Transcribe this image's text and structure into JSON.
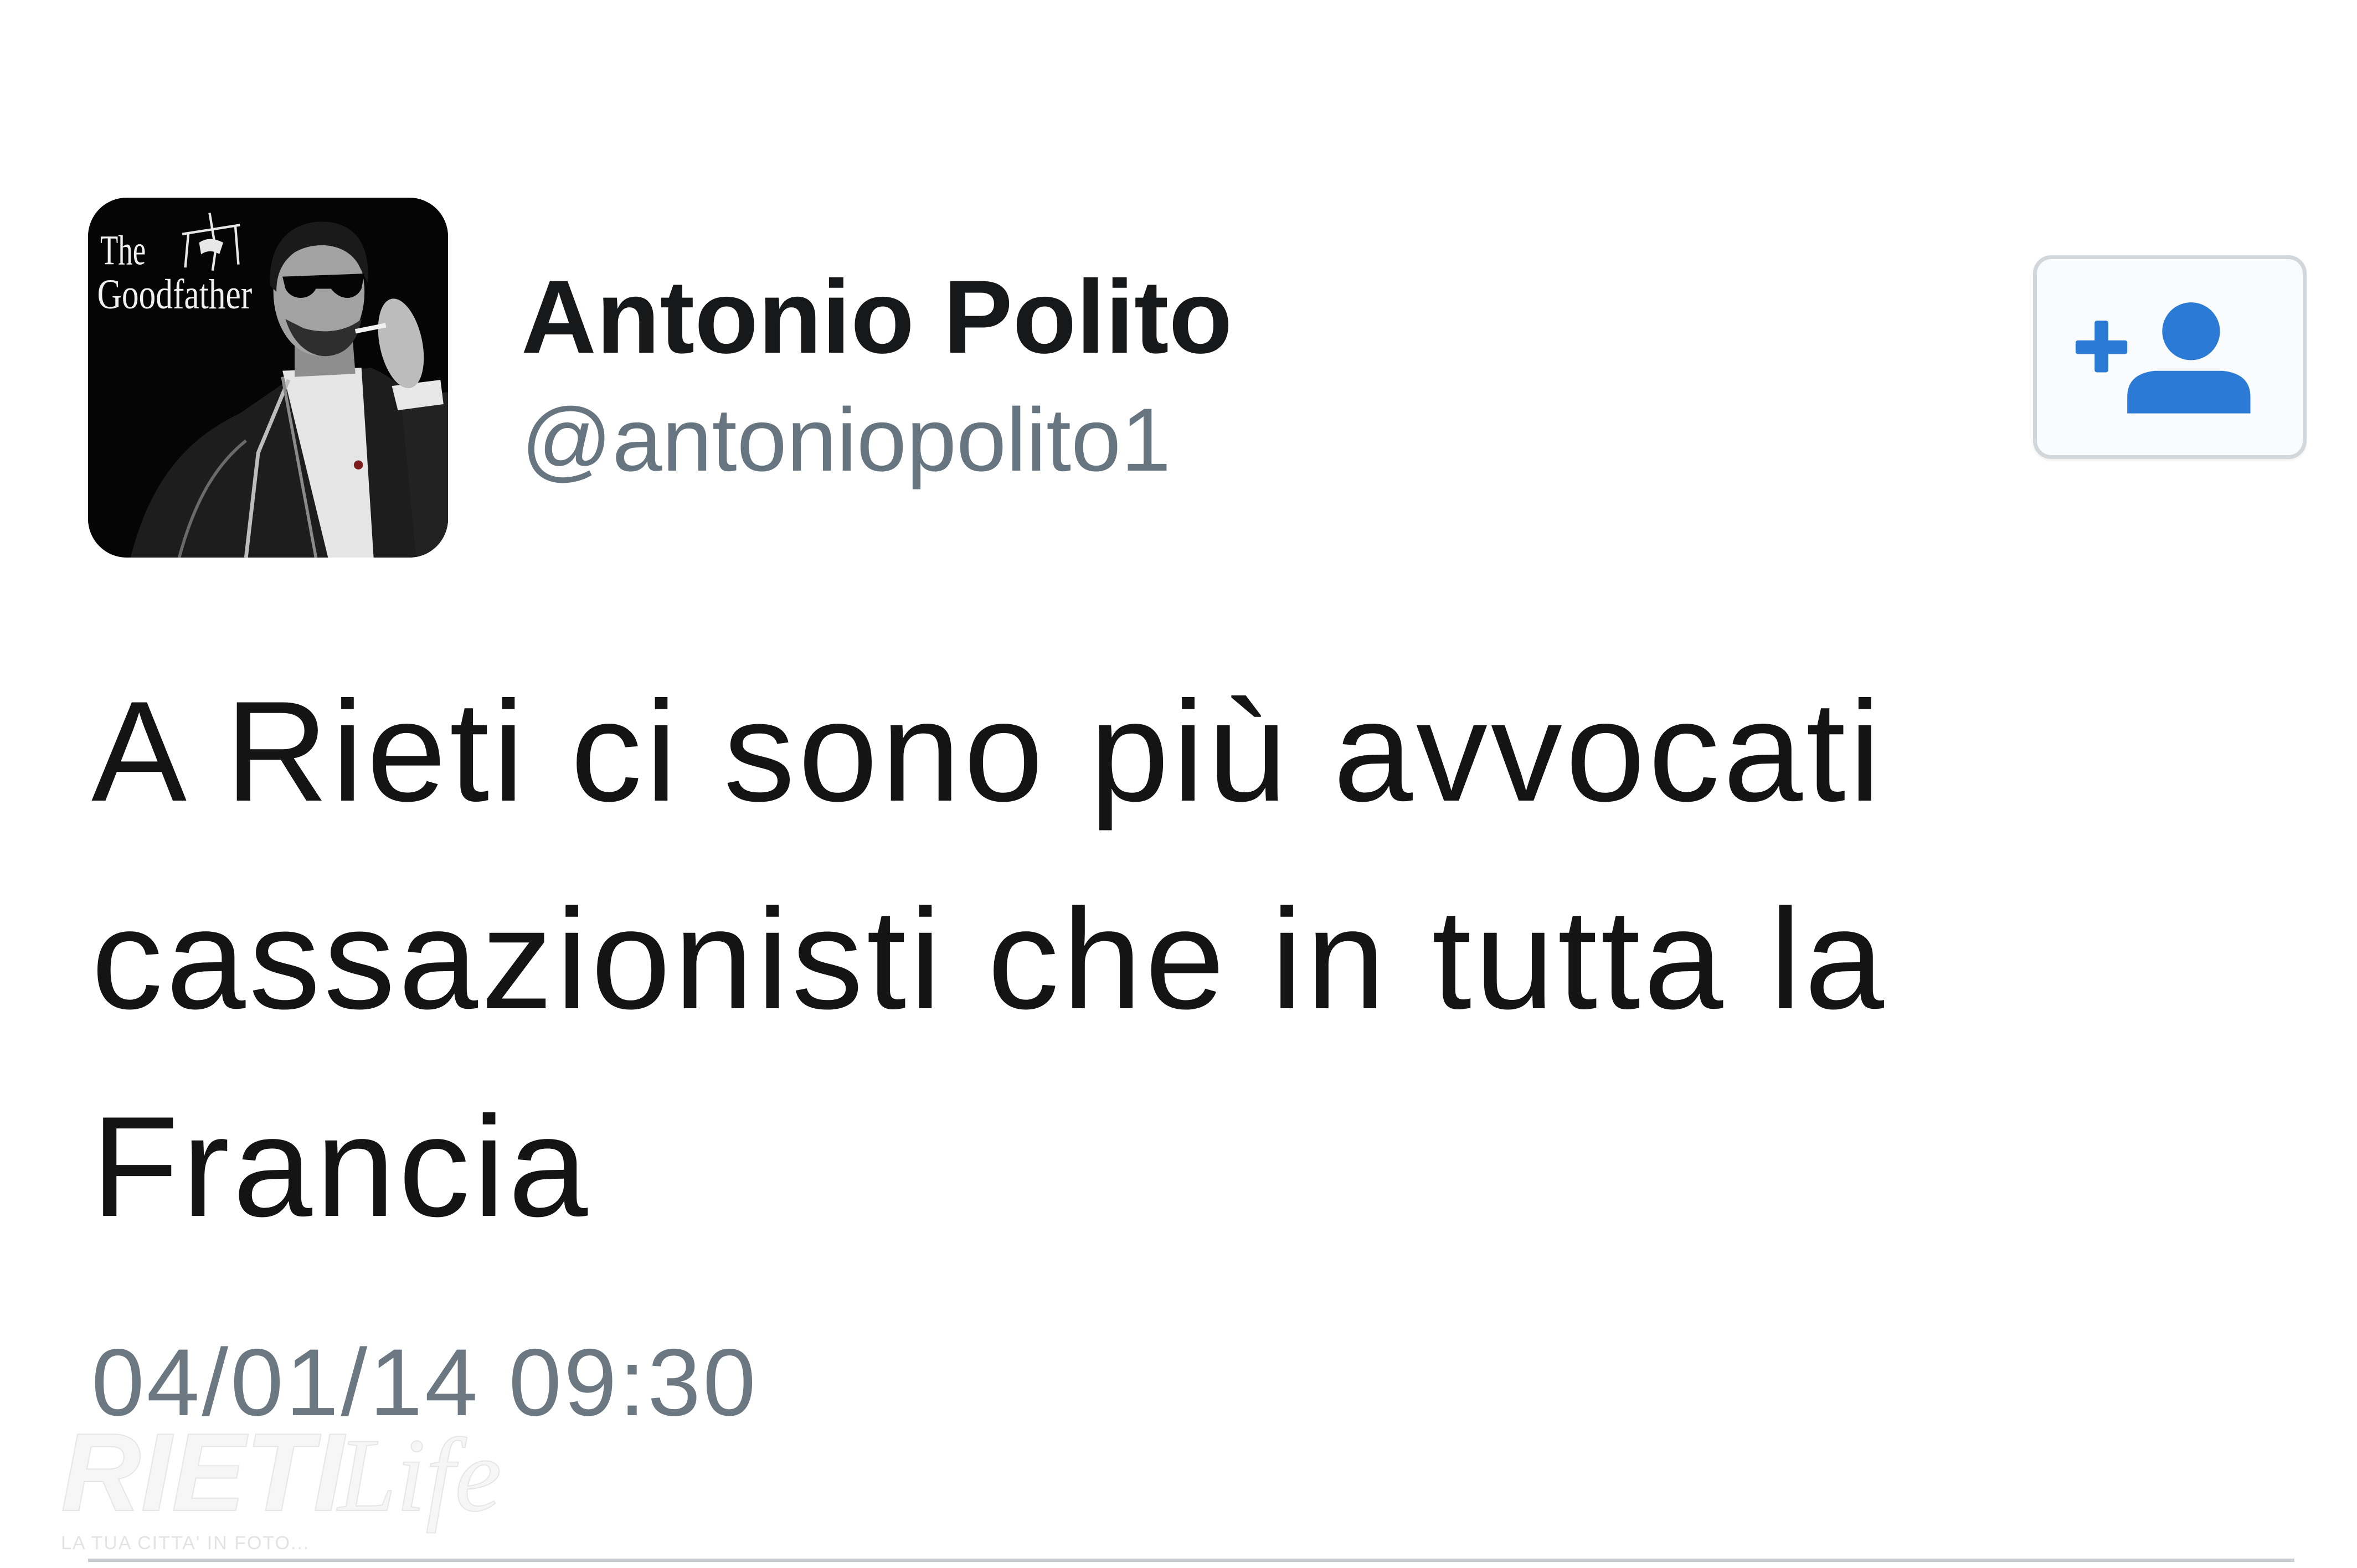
{
  "tweet": {
    "author": {
      "name": "Antonio Polito",
      "handle": "@antoniopolito1",
      "avatar": {
        "icon": "goodfather-avatar",
        "logo_text_line1": "The",
        "logo_text_line2": "Goodfather"
      }
    },
    "follow_button": {
      "icon": "follow-user-icon",
      "accent_color": "#2b7bd6"
    },
    "text": "A Rieti ci sono più avvocati cassazionisti che in tutta la Francia",
    "timestamp": "04/01/14 09:30"
  },
  "watermark": {
    "brand_word1": "RIETI",
    "brand_word2": "Life",
    "tagline": "LA TUA CITTA' IN FOTO..."
  },
  "colors": {
    "background": "#ffffff",
    "text": "#141414",
    "secondary_text": "#66757f",
    "accent": "#2b7bd6"
  }
}
